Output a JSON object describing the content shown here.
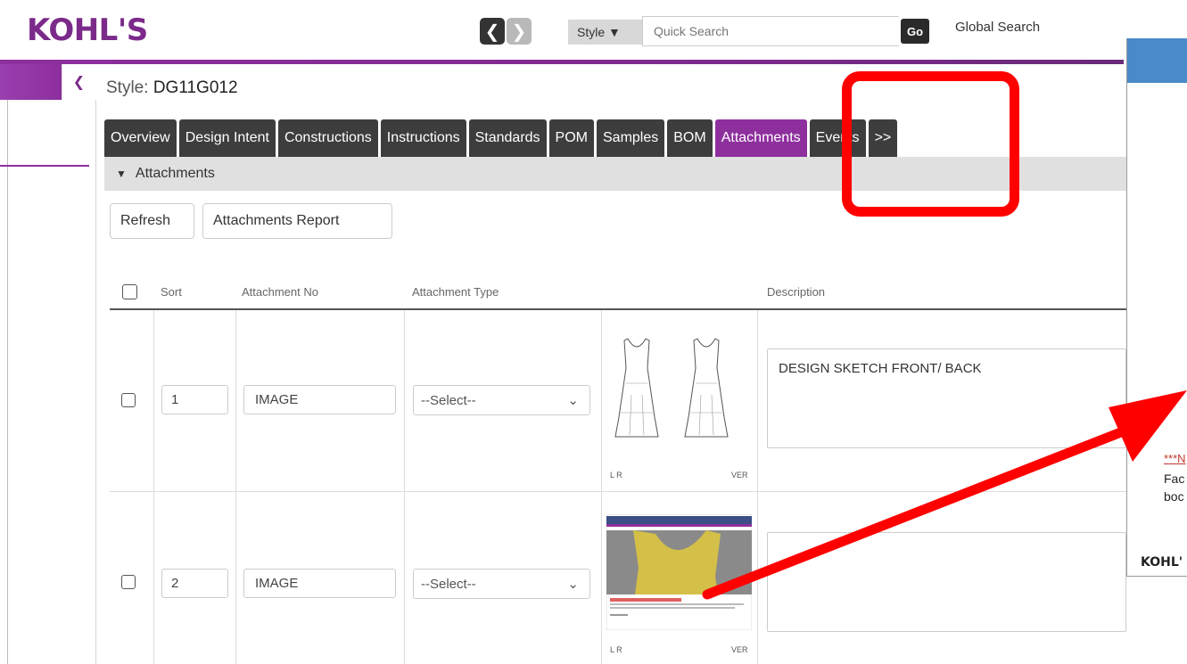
{
  "header": {
    "logo_text": "KOHL'S",
    "nav_prev": "❮",
    "nav_next": "❯",
    "search_type": "Style ▼",
    "search_placeholder": "Quick Search",
    "go_label": "Go",
    "global_search": "Global Search"
  },
  "sidebar": {
    "collapse_icon": "❮"
  },
  "page": {
    "style_label": "Style:",
    "style_code": "DG11G012"
  },
  "tabs": [
    {
      "label": "Overview",
      "active": false
    },
    {
      "label": "Design Intent",
      "active": false
    },
    {
      "label": "Constructions",
      "active": false
    },
    {
      "label": "Instructions",
      "active": false
    },
    {
      "label": "Standards",
      "active": false
    },
    {
      "label": "POM",
      "active": false
    },
    {
      "label": "Samples",
      "active": false
    },
    {
      "label": "BOM",
      "active": false
    },
    {
      "label": "Attachments",
      "active": true
    },
    {
      "label": "Events",
      "active": false
    },
    {
      "label": ">>",
      "active": false
    }
  ],
  "section": {
    "title": "Attachments"
  },
  "buttons": {
    "refresh": "Refresh",
    "report": "Attachments Report"
  },
  "table": {
    "headers": {
      "sort": "Sort",
      "attachment_no": "Attachment No",
      "attachment_type": "Attachment Type",
      "description": "Description"
    },
    "rows": [
      {
        "sort": "1",
        "attachment_no": "IMAGE",
        "attachment_type": "--Select--",
        "thumb_left": "L R",
        "thumb_right": "VER",
        "description": "DESIGN SKETCH FRONT/ BACK"
      },
      {
        "sort": "2",
        "attachment_no": "IMAGE",
        "attachment_type": "--Select--",
        "thumb_left": "L R",
        "thumb_right": "VER",
        "description": ""
      }
    ]
  },
  "popup": {
    "note_red": "***N",
    "line1": "Fac",
    "line2": "boc",
    "logo": "KOHL'"
  },
  "colors": {
    "brand_purple": "#8e2f9e",
    "tab_dark": "#3d3d3d",
    "annotation_red": "#ff0000",
    "popup_header_blue": "#4a8ac8"
  }
}
